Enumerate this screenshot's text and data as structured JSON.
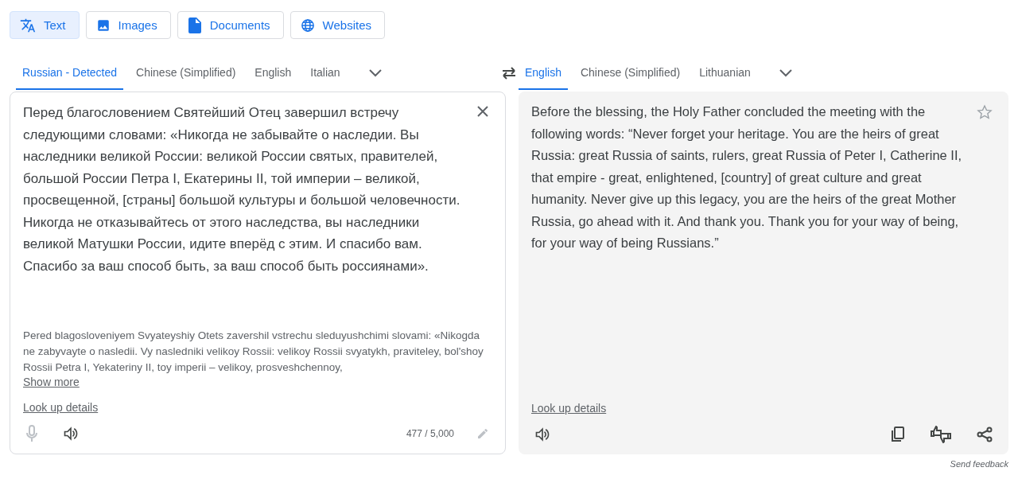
{
  "modes": [
    {
      "label": "Text",
      "kind": "translate",
      "selected": true
    },
    {
      "label": "Images",
      "kind": "image",
      "selected": false
    },
    {
      "label": "Documents",
      "kind": "document",
      "selected": false
    },
    {
      "label": "Websites",
      "kind": "globe",
      "selected": false
    }
  ],
  "source_languages": [
    {
      "label": "Russian - Detected",
      "selected": true
    },
    {
      "label": "Chinese (Simplified)",
      "selected": false
    },
    {
      "label": "English",
      "selected": false
    },
    {
      "label": "Italian",
      "selected": false
    }
  ],
  "target_languages": [
    {
      "label": "English",
      "selected": true
    },
    {
      "label": "Chinese (Simplified)",
      "selected": false
    },
    {
      "label": "Lithuanian",
      "selected": false
    }
  ],
  "source": {
    "text": "Перед благословением Святейший Отец завершил встречу следующими словами: «Никогда не забывайте о наследии. Вы наследники великой России: великой России святых, правителей, большой России Петра I, Екатерины II, той империи – великой, просвещенной, [страны] большой культуры и большой человечности. Никогда не отказывайтесь от этого наследства, вы наследники великой Матушки России, идите вперёд с этим. И спасибо вам. Спасибо за ваш способ быть, за ваш способ быть россиянами».",
    "romanization": "Pered blagosloveniyem Svyateyshiy Otets zavershil vstrechu sleduyushchimi slovami: «Nikogda ne zabyvayte o nasledii. Vy nasledniki velikoy Rossii: velikoy Rossii svyatykh, praviteley, bol'shoy Rossii Petra I, Yekateriny II, toy imperii – velikoy, prosveshchennoy,",
    "show_more": "Show more",
    "look_up": "Look up details",
    "mic_disabled": true,
    "char_count": "477 / 5,000"
  },
  "translation": {
    "text": "Before the blessing, the Holy Father concluded the meeting with the following words: “Never forget your heritage. You are the heirs of great Russia: great Russia of saints, rulers, great Russia of Peter I, Catherine II, that empire - great, enlightened, [country] of great culture and great humanity. Never give up this legacy, you are the heirs of the great Mother Russia, go ahead with it. And thank you. Thank you for your way of being, for your way of being Russians.”",
    "saved": false,
    "look_up": "Look up details"
  },
  "send_feedback": "Send feedback"
}
